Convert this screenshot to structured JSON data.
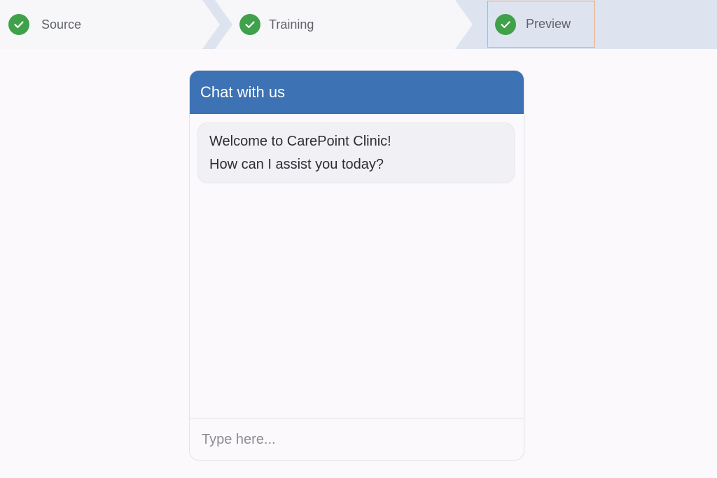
{
  "stepper": {
    "steps": [
      {
        "label": "Source",
        "icon": "check-circle-icon",
        "status": "complete"
      },
      {
        "label": "Training",
        "icon": "check-circle-icon",
        "status": "complete"
      },
      {
        "label": "Preview",
        "icon": "check-circle-icon",
        "status": "complete",
        "current": true
      }
    ],
    "colors": {
      "complete": "#3fa14a",
      "step_bg": "#f7f6f9",
      "current_bg": "#dde3ef",
      "focus_outline": "#f1a56e"
    }
  },
  "chat": {
    "title": "Chat with us",
    "header_color": "#3d72b4",
    "messages": [
      {
        "sender": "bot",
        "lines": [
          "Welcome to CarePoint Clinic!",
          "How can I assist you today?"
        ]
      }
    ],
    "input": {
      "placeholder": "Type here...",
      "value": ""
    }
  }
}
